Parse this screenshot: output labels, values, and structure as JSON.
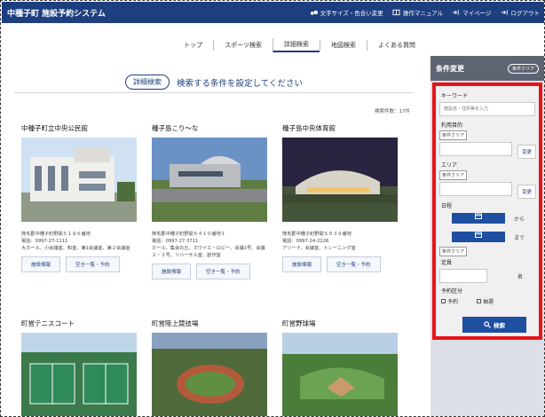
{
  "header": {
    "app_title": "中種子町 施設予約システム",
    "utility": {
      "font_size": "文字サイズ・色合い変更",
      "manual": "操作マニュアル",
      "mypage": "マイページ",
      "login": "ログアウト"
    }
  },
  "nav": {
    "items": [
      "トップ",
      "スポーツ検索",
      "詳細検索",
      "地図検索",
      "よくある質問"
    ]
  },
  "main": {
    "search_badge": "詳細検索",
    "search_title": "検索する条件を設定してください",
    "result_count": "検索件数：17件",
    "facilities": [
      {
        "name": "中種子町立中央公民館",
        "address": "熊毛郡中種子町野間５１８６番地",
        "tel": "電話：0997-27-1111",
        "rooms": "大ホール、小会議室、和室、第1会議室、第２会議室",
        "btn_info": "施設情報",
        "btn_avail": "空き一覧・予約"
      },
      {
        "name": "種子島こり～な",
        "address": "熊毛郡中種子町野間６４１０番地１",
        "tel": "電話：0997-27-3711",
        "rooms": "ホール、集会の丘、ホワイエ・ロビー、会議1号、会議２・３号、リハーサル室、創作室",
        "btn_info": "施設情報",
        "btn_avail": "空き一覧・予約"
      },
      {
        "name": "種子島中央体育館",
        "address": "熊毛郡中種子町野間５９３９番地",
        "tel": "電話：0997-24-2226",
        "rooms": "アリーナ、会議室、トレーニング室",
        "btn_info": "施設情報",
        "btn_avail": "空き一覧・予約"
      },
      {
        "name": "町営テニスコート"
      },
      {
        "name": "町営陸上競技場"
      },
      {
        "name": "町営野球場"
      }
    ]
  },
  "sidebar": {
    "title": "条件変更",
    "clear_all": "条件クリア",
    "keyword_label": "キーワード",
    "keyword_placeholder": "施設名・住所等を入力",
    "purpose_label": "利用目的",
    "clear_label": "条件クリア",
    "change_label": "変更",
    "area_label": "エリア",
    "date_label": "日程",
    "from_suffix": "から",
    "to_suffix": "まで",
    "capacity_label": "定員",
    "capacity_unit": "名",
    "reserve_label": "予約区分",
    "reserve_opt1": "予約",
    "reserve_opt2": "抽選",
    "search_button": "検索"
  },
  "colors": {
    "header_bg": "#1e3f7f",
    "highlight_border": "#e8141a",
    "sidebar_head_bg": "#5d6472"
  }
}
